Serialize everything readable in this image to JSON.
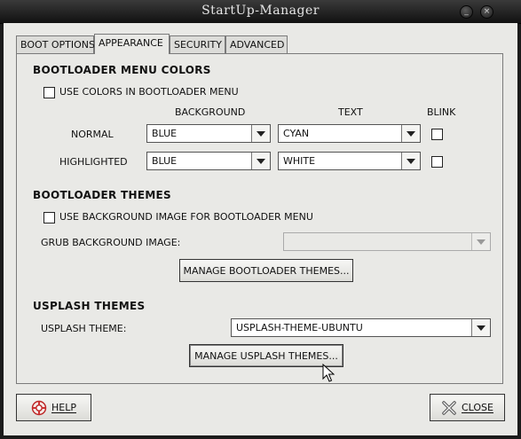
{
  "window": {
    "title": "StartUp-Manager"
  },
  "titlebar_buttons": {
    "minimize": "_",
    "close": "×"
  },
  "tabs": [
    {
      "label": "BOOT OPTIONS",
      "active": false
    },
    {
      "label": "APPEARANCE",
      "active": true
    },
    {
      "label": "SECURITY",
      "active": false
    },
    {
      "label": "ADVANCED",
      "active": false
    }
  ],
  "colors_section": {
    "title": "BOOTLOADER MENU COLORS",
    "use_colors_label": "USE COLORS IN BOOTLOADER MENU",
    "use_colors_checked": false,
    "col_background": "BACKGROUND",
    "col_text": "TEXT",
    "col_blink": "BLINK",
    "normal_label": "NORMAL",
    "normal_background": "BLUE",
    "normal_text": "CYAN",
    "normal_blink": false,
    "highlighted_label": "HIGHLIGHTED",
    "highlighted_background": "BLUE",
    "highlighted_text": "WHITE",
    "highlighted_blink": false
  },
  "themes_section": {
    "title": "BOOTLOADER THEMES",
    "use_bg_label": "USE BACKGROUND IMAGE FOR BOOTLOADER MENU",
    "use_bg_checked": false,
    "grub_bg_label": "GRUB BACKGROUND IMAGE:",
    "grub_bg_value": "",
    "manage_button": "MANAGE BOOTLOADER THEMES..."
  },
  "usplash_section": {
    "title": "USPLASH THEMES",
    "theme_label": "USPLASH THEME:",
    "theme_value": "USPLASH-THEME-UBUNTU",
    "manage_button": "MANAGE USPLASH THEMES..."
  },
  "footer": {
    "help_button": "HELP",
    "close_button": "CLOSE"
  },
  "icons": {
    "help": "lifebuoy-icon",
    "close": "close-x-icon"
  }
}
